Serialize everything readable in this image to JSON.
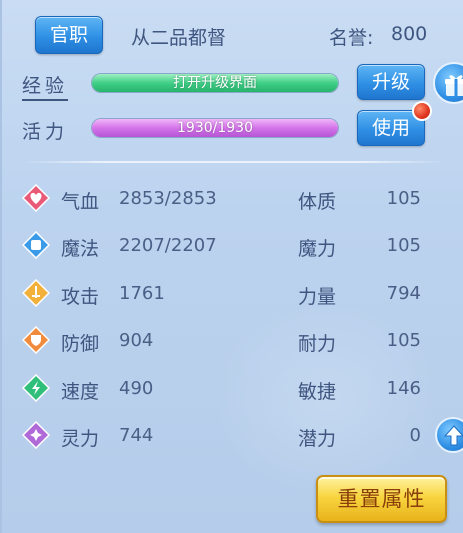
{
  "header": {
    "rank_button": "官职",
    "rank_title": "从二品都督",
    "honor_label": "名誉:",
    "honor_value": "800"
  },
  "experience": {
    "label": "经验",
    "bar_text": "打开升级界面",
    "fill_fraction": 1.0,
    "button": "升级"
  },
  "vitality": {
    "label": "活力",
    "bar_text": "1930/1930",
    "fill_fraction": 1.0,
    "button": "使用"
  },
  "stats": [
    {
      "icon": "heart-icon",
      "color": "#e85a78",
      "name": "气血",
      "value": "2853/2853",
      "attr_name": "体质",
      "attr_value": "105"
    },
    {
      "icon": "magic-icon",
      "color": "#3b9be8",
      "name": "魔法",
      "value": "2207/2207",
      "attr_name": "魔力",
      "attr_value": "105"
    },
    {
      "icon": "sword-icon",
      "color": "#f2b13a",
      "name": "攻击",
      "value": "1761",
      "attr_name": "力量",
      "attr_value": "794"
    },
    {
      "icon": "shield-icon",
      "color": "#f08a3c",
      "name": "防御",
      "value": "904",
      "attr_name": "耐力",
      "attr_value": "105"
    },
    {
      "icon": "lightning-icon",
      "color": "#2fbf7a",
      "name": "速度",
      "value": "490",
      "attr_name": "敏捷",
      "attr_value": "146"
    },
    {
      "icon": "spirit-icon",
      "color": "#b06ad8",
      "name": "灵力",
      "value": "744",
      "attr_name": "潜力",
      "attr_value": "0"
    }
  ],
  "reset_button": "重置属性",
  "colors": {
    "button_blue": "#2f8fe4",
    "button_gold": "#f8d540",
    "exp_green": "#3fcf86",
    "vitality_purple": "#d474ea",
    "notify_red": "#e0361e"
  }
}
